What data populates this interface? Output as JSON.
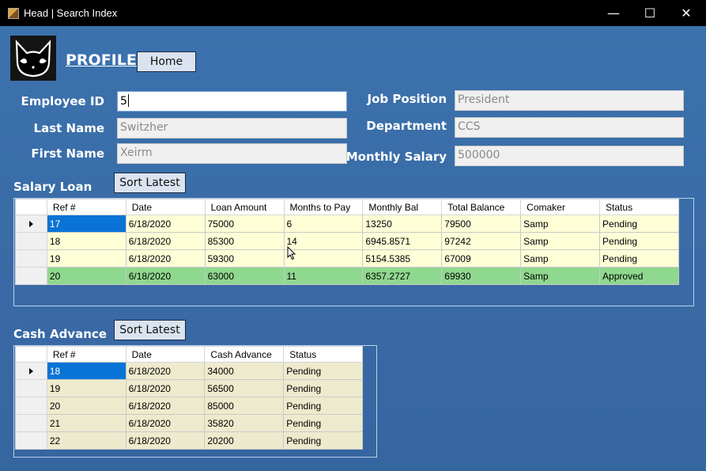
{
  "window": {
    "title": "Head | Search Index",
    "controls": {
      "minimize": "—",
      "maximize": "☐",
      "close": "✕"
    }
  },
  "header": {
    "title": "PROFILE",
    "home_label": "Home"
  },
  "form": {
    "employee_id": {
      "label": "Employee ID",
      "value": "5"
    },
    "last_name": {
      "label": "Last Name",
      "value": "Switzher"
    },
    "first_name": {
      "label": "First Name",
      "value": "Xeirm"
    },
    "job_position": {
      "label": "Job Position",
      "value": "President"
    },
    "department": {
      "label": "Department",
      "value": "CCS"
    },
    "monthly_salary": {
      "label": "Monthly Salary",
      "value": "500000"
    }
  },
  "salary_loan": {
    "title": "Salary Loan",
    "sort_label": "Sort Latest",
    "columns": [
      "Ref #",
      "Date",
      "Loan Amount",
      "Months to Pay",
      "Monthly Bal",
      "Total Balance",
      "Comaker",
      "Status"
    ],
    "rows": [
      [
        "17",
        "6/18/2020",
        "75000",
        "6",
        "13250",
        "79500",
        "Samp",
        "Pending"
      ],
      [
        "18",
        "6/18/2020",
        "85300",
        "14",
        "6945.8571",
        "97242",
        "Samp",
        "Pending"
      ],
      [
        "19",
        "6/18/2020",
        "59300",
        "",
        "5154.5385",
        "67009",
        "Samp",
        "Pending"
      ],
      [
        "20",
        "6/18/2020",
        "63000",
        "11",
        "6357.2727",
        "69930",
        "Samp",
        "Approved"
      ]
    ]
  },
  "cash_advance": {
    "title": "Cash Advance",
    "sort_label": "Sort Latest",
    "columns": [
      "Ref #",
      "Date",
      "Cash Advance",
      "Status"
    ],
    "rows": [
      [
        "18",
        "6/18/2020",
        "34000",
        "Pending"
      ],
      [
        "19",
        "6/18/2020",
        "56500",
        "Pending"
      ],
      [
        "20",
        "6/18/2020",
        "85000",
        "Pending"
      ],
      [
        "21",
        "6/18/2020",
        "35820",
        "Pending"
      ],
      [
        "22",
        "6/18/2020",
        "20200",
        "Pending"
      ]
    ]
  },
  "colors": {
    "background": "#3a6da6",
    "selected_cell": "#0a74d6",
    "pending_row": "#fefed7",
    "approved_row": "#8fd88f",
    "cash_row": "#eeeacd"
  }
}
